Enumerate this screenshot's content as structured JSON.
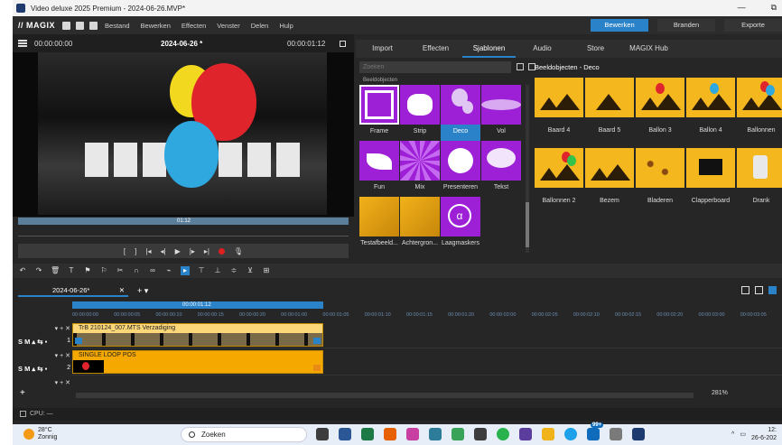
{
  "window": {
    "title": "Video deluxe 2025 Premium - 2024-06-26.MVP*",
    "minimize": "—",
    "restore": "⧉"
  },
  "menubar": {
    "logo": "// MAGIX",
    "items": [
      "Bestand",
      "Bewerken",
      "Effecten",
      "Venster",
      "Delen",
      "Hulp"
    ],
    "modes": [
      "Bewerken",
      "Branden",
      "Exporte"
    ],
    "active_mode": "Bewerken"
  },
  "preview": {
    "timecode_left": "00:00:00:00",
    "project_name": "2024-06-26 *",
    "timecode_right": "00:00:01:12",
    "scrub_label": "01:12"
  },
  "transport": {
    "buttons": [
      "[",
      "]",
      "|◂",
      "◂|",
      "▶",
      "|▸",
      "▸|",
      "🎙"
    ]
  },
  "tabs": {
    "items": [
      "Import",
      "Effecten",
      "Sjablonen",
      "Audio",
      "Store",
      "MAGIX Hub"
    ],
    "active": "Sjablonen"
  },
  "search": {
    "placeholder": "Zoeken"
  },
  "templates": {
    "category": "Beeldobjecten",
    "items": [
      {
        "label": "Frame"
      },
      {
        "label": "Strip"
      },
      {
        "label": "Deco"
      },
      {
        "label": "Vol"
      },
      {
        "label": "Fun"
      },
      {
        "label": "Mix"
      },
      {
        "label": "Presenteren"
      },
      {
        "label": "Tekst"
      },
      {
        "label": "Testafbeeld..."
      },
      {
        "label": "Achtergron..."
      },
      {
        "label": "Laagmaskers"
      }
    ],
    "selected": "Deco"
  },
  "objects": {
    "title": "Beeldobjecten - Deco",
    "items": [
      {
        "label": "Baard 4"
      },
      {
        "label": "Baard 5"
      },
      {
        "label": "Ballon 3"
      },
      {
        "label": "Ballon 4"
      },
      {
        "label": "Ballonnen"
      },
      {
        "label": "Ballonnen 2"
      },
      {
        "label": "Bezem"
      },
      {
        "label": "Bladeren"
      },
      {
        "label": "Clapperboard"
      },
      {
        "label": "Drank"
      }
    ]
  },
  "project_tab": {
    "name": "2024-06-26*",
    "close": "✕",
    "add": "+ ▾"
  },
  "timeline": {
    "range_label": "00:00:01:12",
    "ruler_ticks": [
      "00:00:00:00",
      "00:00:00:05",
      "00:00:00:10",
      "00:00:00:15",
      "00:00:00:20",
      "00:00:01:00",
      "00:00:01:05",
      "00:00:01:10",
      "00:00:01:15",
      "00:00:01:20",
      "00:00:02:00",
      "00:00:02:05",
      "00:00:02:10",
      "00:00:02:15",
      "00:00:02:20",
      "00:00:03:00",
      "00:00:03:05"
    ],
    "tracks": [
      {
        "number": "1",
        "controls": "S M ▴ ⇆ ▪",
        "clip": "TrB 210124_007.MTS   Verzadiging"
      },
      {
        "number": "2",
        "controls": "S M ▴ ⇆ ▪",
        "clip": "SINGLE LOOP POS"
      }
    ],
    "track_top_controls": "▾ + ✕",
    "zoom": "281%"
  },
  "status": {
    "cpu": "CPU: —"
  },
  "taskbar": {
    "temperature": "28°C",
    "weather": "Zonnig",
    "search": "Zoeken",
    "badge": "99+",
    "time": "12:",
    "date": "26-6-202"
  }
}
